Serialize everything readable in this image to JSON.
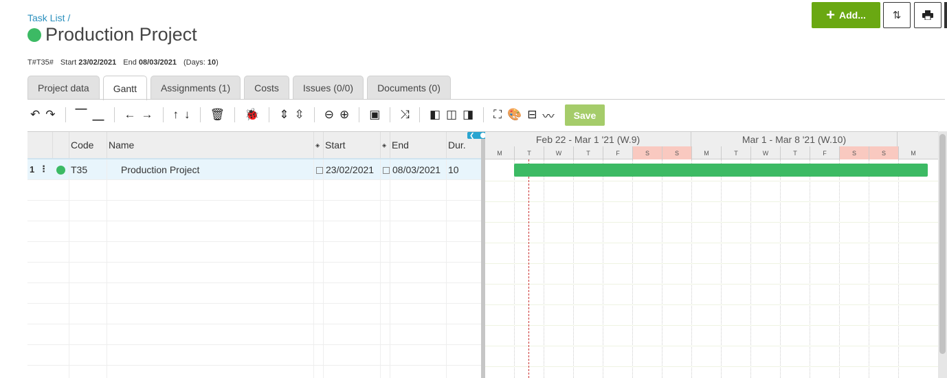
{
  "breadcrumb": "Task List /",
  "project": {
    "title": "Production Project",
    "status_color": "#3cba64"
  },
  "meta": {
    "code_label": "T#T35#",
    "start_label": "Start",
    "start_value": "23/02/2021",
    "end_label": "End",
    "end_value": "08/03/2021",
    "days_label": "(Days:",
    "days_value": "10",
    "days_close": ")"
  },
  "header_buttons": {
    "add_label": "Add...",
    "add_icon": "plus-icon",
    "sort_icon": "sort-icon",
    "print_icon": "print-icon"
  },
  "tabs": [
    {
      "label": "Project data",
      "active": false
    },
    {
      "label": "Gantt",
      "active": true
    },
    {
      "label": "Assignments (1)",
      "active": false
    },
    {
      "label": "Costs",
      "active": false
    },
    {
      "label": "Issues (0/0)",
      "active": false
    },
    {
      "label": "Documents (0)",
      "active": false
    }
  ],
  "toolbar": {
    "save_label": "Save",
    "save_color": "#a5cc6a"
  },
  "grid": {
    "columns": {
      "code": "Code",
      "name": "Name",
      "start": "Start",
      "end": "End",
      "dur": "Dur."
    },
    "rows": [
      {
        "num": "1",
        "code": "T35",
        "name": "Production Project",
        "start": "23/02/2021",
        "end": "08/03/2021",
        "dur": "10"
      }
    ]
  },
  "gantt": {
    "weeks": [
      "Feb 22 - Mar 1 '21 (W.9)",
      "Mar 1 - Mar 8 '21 (W.10)"
    ],
    "days": [
      "M",
      "T",
      "W",
      "T",
      "F",
      "S",
      "S",
      "M",
      "T",
      "W",
      "T",
      "F",
      "S",
      "S",
      "M"
    ],
    "weekend_color": "#f9c9c0",
    "bar_color": "#3cba64",
    "bar_start_day_index": 1,
    "bar_duration_days": 14
  }
}
